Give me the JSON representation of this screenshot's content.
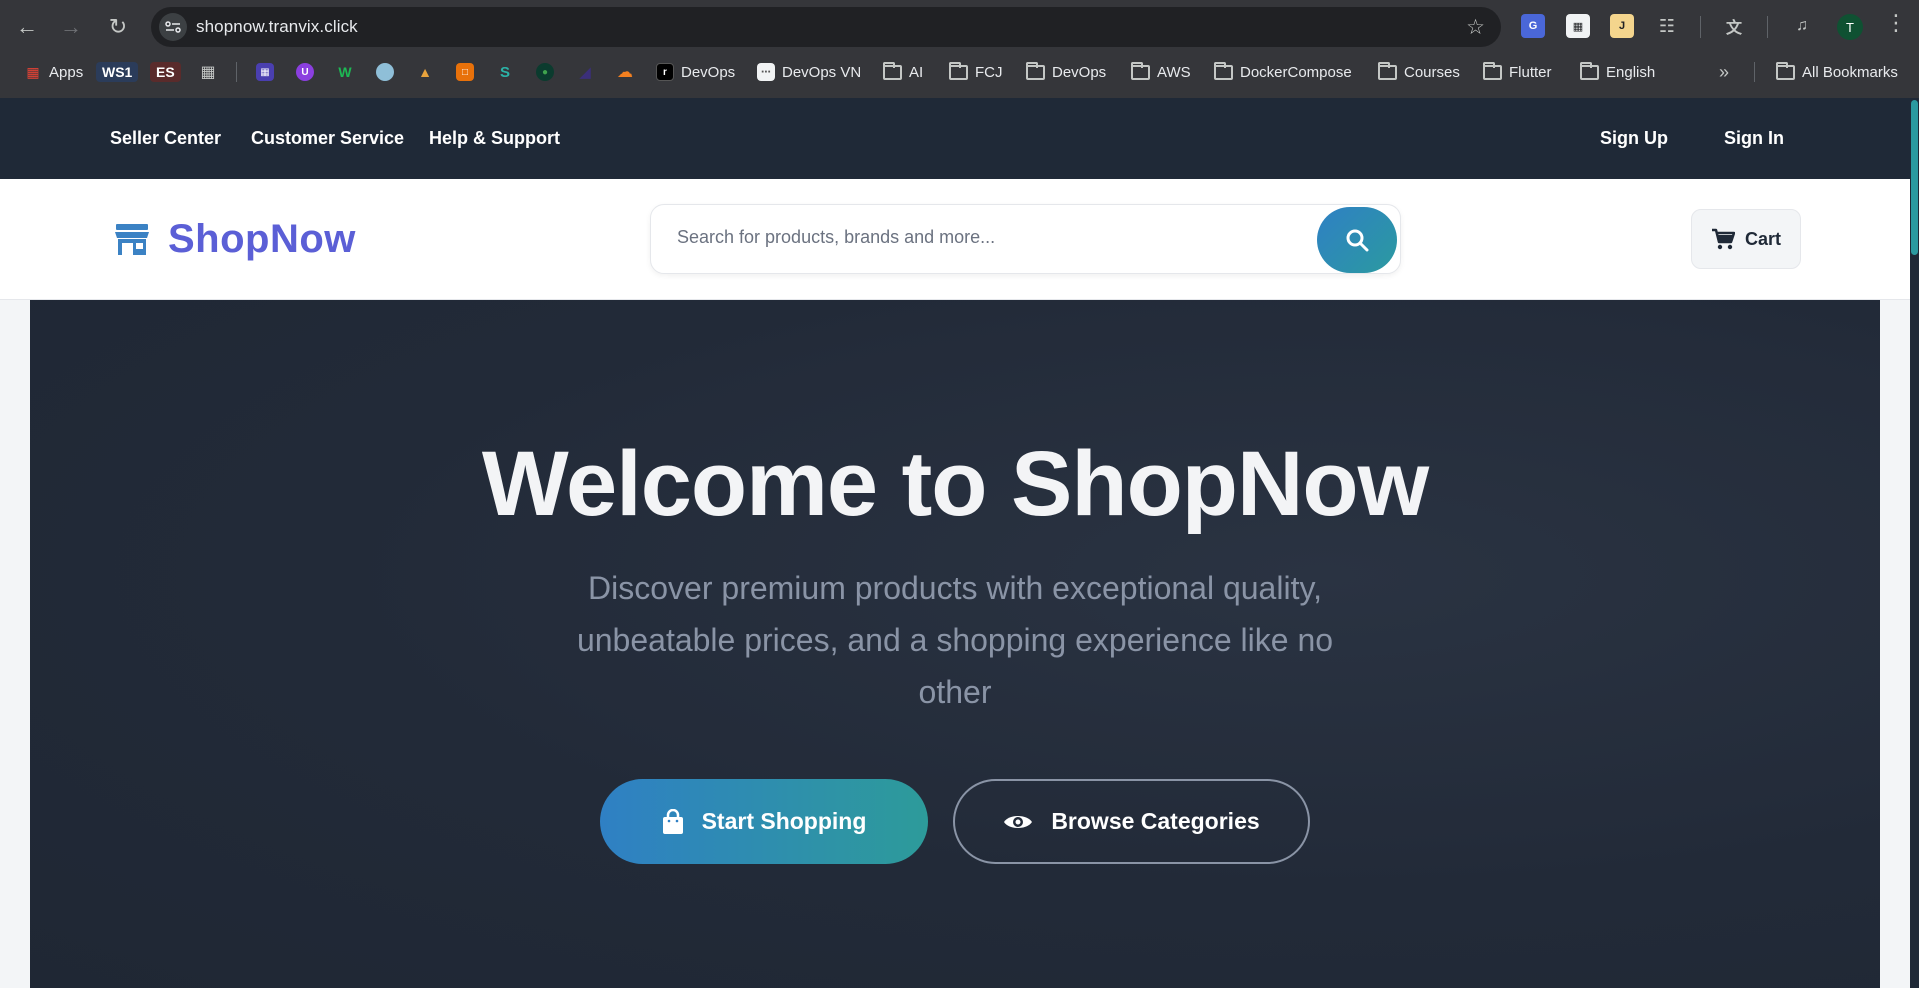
{
  "browser": {
    "url": "shopnow.tranvix.click",
    "profile_initial": "T",
    "bookmarks": [
      {
        "label": "Apps"
      },
      {
        "label": "WS1"
      },
      {
        "label": "ES"
      },
      {
        "label": "DevOps"
      },
      {
        "label": "DevOps VN"
      },
      {
        "label": "AI"
      },
      {
        "label": "FCJ"
      },
      {
        "label": "DevOps"
      },
      {
        "label": "AWS"
      },
      {
        "label": "DockerCompose"
      },
      {
        "label": "Courses"
      },
      {
        "label": "Flutter"
      },
      {
        "label": "English"
      },
      {
        "label": "All Bookmarks"
      }
    ],
    "overflow_label": "»"
  },
  "topbar": {
    "links": [
      "Seller Center",
      "Customer Service",
      "Help & Support"
    ],
    "sign_up": "Sign Up",
    "sign_in": "Sign In"
  },
  "header": {
    "logo": "ShopNow",
    "search_placeholder": "Search for products, brands and more...",
    "cart_label": "Cart"
  },
  "hero": {
    "title": "Welcome to ShopNow",
    "subtitle": "Discover premium products with exceptional quality, unbeatable prices, and a shopping experience like no other",
    "primary_button": "Start Shopping",
    "secondary_button": "Browse Categories"
  },
  "colors": {
    "brand": "#5b5fd6",
    "accent_gradient_start": "#2f80c4",
    "accent_gradient_end": "#2b9aa0",
    "hero_bg": "#222a38"
  }
}
